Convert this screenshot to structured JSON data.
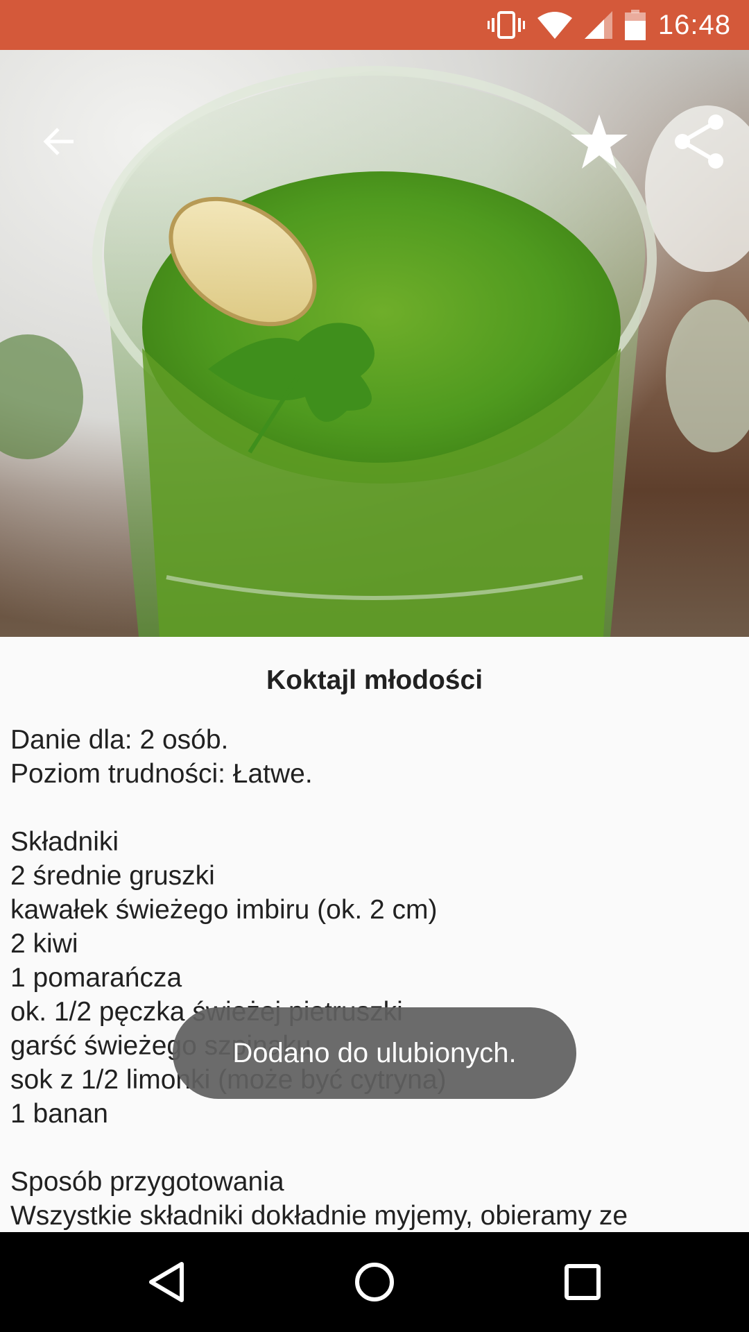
{
  "status_bar": {
    "time": "16:48",
    "icons": [
      "vibrate-icon",
      "wifi-icon",
      "cell-signal-icon",
      "battery-icon"
    ],
    "background": "#d4593a"
  },
  "toolbar": {
    "icons": [
      "arrow-back-icon",
      "star-icon",
      "share-icon"
    ]
  },
  "recipe": {
    "title": "Koktajl młodości",
    "servings": "Danie dla: 2 osób.",
    "difficulty": "Poziom trudności: Łatwe.",
    "ingredients_header": "Składniki",
    "ingredients": [
      "2 średnie gruszki",
      "kawałek świeżego imbiru (ok. 2 cm)",
      "2 kiwi",
      "1 pomarańcza",
      "ok. 1/2 pęczka świeżej pietruszki",
      "garść świeżego szpinaku",
      "sok z 1/2 limonki (może być cytryna)",
      "1 banan"
    ],
    "method_header": "Sposób przygotowania",
    "method_first_line": "Wszystkie składniki dokładnie myjemy, obieramy ze"
  },
  "toast": {
    "message": "Dodano do ulubionych."
  },
  "nav_bar": {
    "icons": [
      "nav-back-icon",
      "nav-home-icon",
      "nav-recents-icon"
    ]
  }
}
